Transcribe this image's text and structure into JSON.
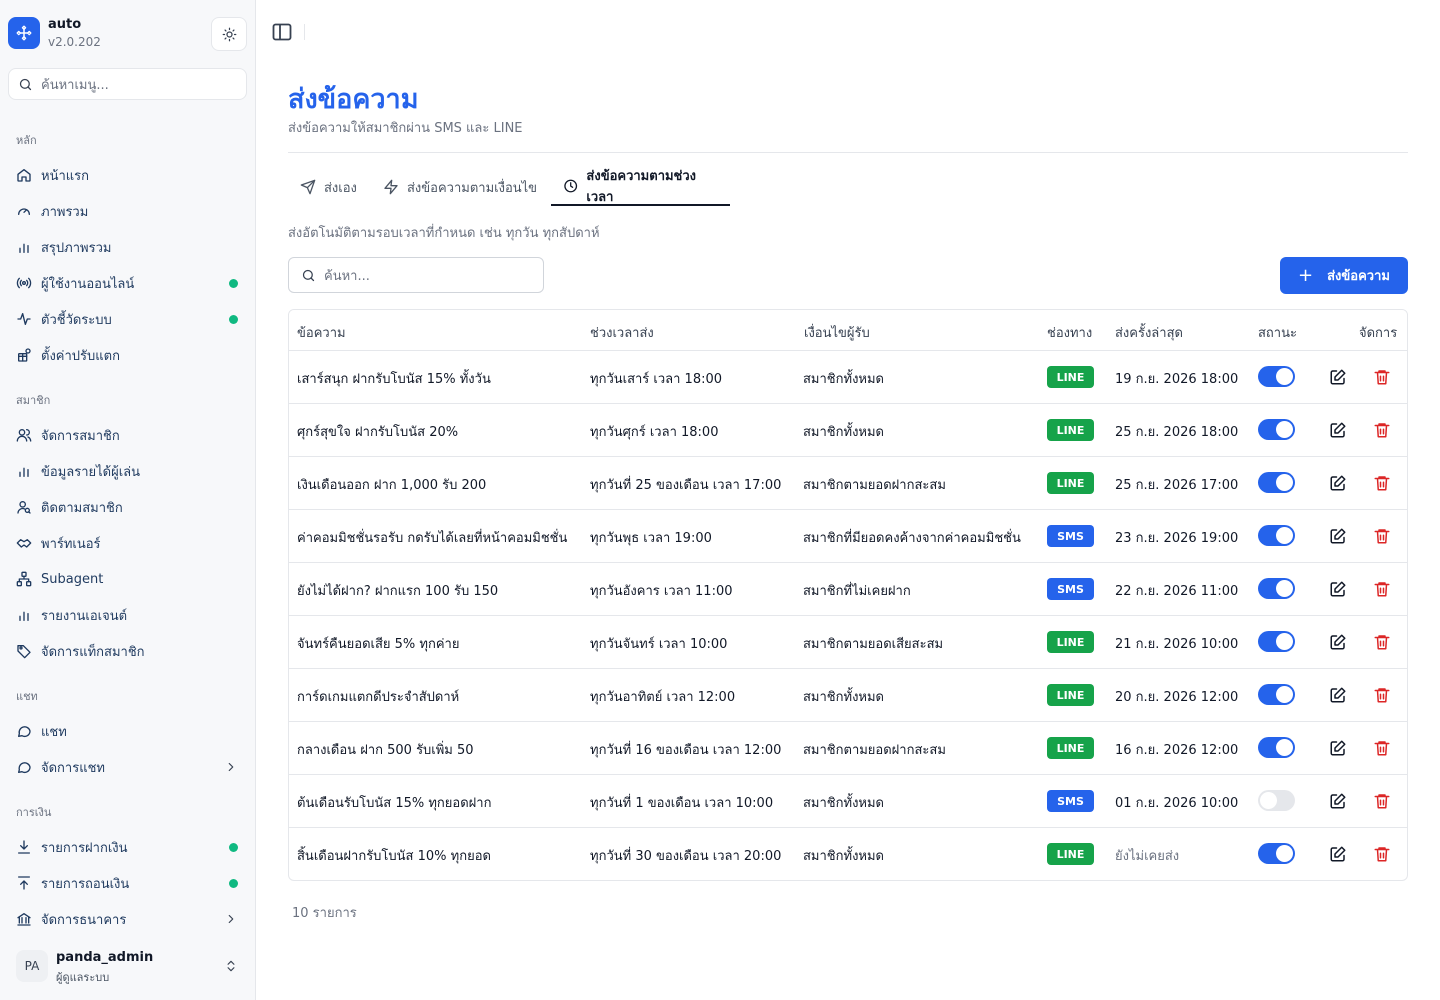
{
  "app": {
    "name": "auto",
    "version": "v2.0.202"
  },
  "menu_search": {
    "placeholder": "ค้นหาเมนู..."
  },
  "sidebar": {
    "sections": [
      {
        "label": "หลัก",
        "items": [
          {
            "label": "หน้าแรก",
            "icon": "home-icon"
          },
          {
            "label": "ภาพรวม",
            "icon": "gauge-icon"
          },
          {
            "label": "สรุปภาพรวม",
            "icon": "bar-chart-icon"
          },
          {
            "label": "ผู้ใช้งานออนไลน์",
            "icon": "broadcast-icon",
            "status_dot": true
          },
          {
            "label": "ตัวชี้วัดระบบ",
            "icon": "activity-icon",
            "status_dot": true
          },
          {
            "label": "ตั้งค่าปรับแตก",
            "icon": "gift-settings-icon"
          }
        ]
      },
      {
        "label": "สมาชิก",
        "items": [
          {
            "label": "จัดการสมาชิก",
            "icon": "users-icon"
          },
          {
            "label": "ข้อมูลรายได้ผู้เล่น",
            "icon": "bar-chart-icon"
          },
          {
            "label": "ติดตามสมาชิก",
            "icon": "user-search-icon"
          },
          {
            "label": "พาร์ทเนอร์",
            "icon": "handshake-icon"
          },
          {
            "label": "Subagent",
            "icon": "network-icon"
          },
          {
            "label": "รายงานเอเจนต์",
            "icon": "bar-chart-icon"
          },
          {
            "label": "จัดการแท็กสมาชิก",
            "icon": "tag-icon"
          }
        ]
      },
      {
        "label": "แชท",
        "items": [
          {
            "label": "แชท",
            "icon": "chat-icon"
          },
          {
            "label": "จัดการแชท",
            "icon": "chat-icon",
            "expandable": true
          }
        ]
      },
      {
        "label": "การเงิน",
        "items": [
          {
            "label": "รายการฝากเงิน",
            "icon": "download-icon",
            "status_dot": true
          },
          {
            "label": "รายการถอนเงิน",
            "icon": "upload-icon",
            "status_dot": true
          },
          {
            "label": "จัดการธนาคาร",
            "icon": "bank-icon",
            "expandable": true
          }
        ]
      }
    ]
  },
  "user": {
    "initials": "PA",
    "name": "panda_admin",
    "role": "ผู้ดูแลระบบ"
  },
  "page": {
    "title": "ส่งข้อความ",
    "subtitle": "ส่งข้อความให้สมาชิกผ่าน SMS และ LINE"
  },
  "tabs": [
    {
      "label": "ส่งเอง",
      "icon": "send-icon",
      "active": false
    },
    {
      "label": "ส่งข้อความตามเงื่อนไข",
      "icon": "zap-icon",
      "active": false
    },
    {
      "label": "ส่งข้อความตามช่วงเวลา",
      "icon": "clock-icon",
      "active": true
    }
  ],
  "tab_description": "ส่งอัตโนมัติตามรอบเวลาที่กำหนด เช่น ทุกวัน ทุกสัปดาห์",
  "search": {
    "placeholder": "ค้นหา..."
  },
  "actions": {
    "send_message_label": "ส่งข้อความ",
    "plus": "+"
  },
  "table": {
    "columns": [
      "ข้อความ",
      "ช่วงเวลาส่ง",
      "เงื่อนไขผู้รับ",
      "ช่องทาง",
      "ส่งครั้งล่าสุด",
      "สถานะ",
      "จัดการ"
    ],
    "rows": [
      {
        "message": "เสาร์สนุก ฝากรับโบนัส 15% ทั้งวัน",
        "schedule": "ทุกวันเสาร์ เวลา 18:00",
        "recipients": "สมาชิกทั้งหมด",
        "channel": "LINE",
        "last_sent": "19 ก.ย. 2026 18:00",
        "enabled": true
      },
      {
        "message": "ศุกร์สุขใจ ฝากรับโบนัส 20%",
        "schedule": "ทุกวันศุกร์ เวลา 18:00",
        "recipients": "สมาชิกทั้งหมด",
        "channel": "LINE",
        "last_sent": "25 ก.ย. 2026 18:00",
        "enabled": true
      },
      {
        "message": "เงินเดือนออก ฝาก 1,000 รับ 200",
        "schedule": "ทุกวันที่ 25 ของเดือน เวลา 17:00",
        "recipients": "สมาชิกตามยอดฝากสะสม",
        "channel": "LINE",
        "last_sent": "25 ก.ย. 2026 17:00",
        "enabled": true
      },
      {
        "message": "ค่าคอมมิชชั่นรอรับ กดรับได้เลยที่หน้าคอมมิชชั่น",
        "schedule": "ทุกวันพุธ เวลา 19:00",
        "recipients": "สมาชิกที่มียอดคงค้างจากค่าคอมมิชชั่น",
        "channel": "SMS",
        "last_sent": "23 ก.ย. 2026 19:00",
        "enabled": true
      },
      {
        "message": "ยังไม่ได้ฝาก? ฝากแรก 100 รับ 150",
        "schedule": "ทุกวันอังคาร เวลา 11:00",
        "recipients": "สมาชิกที่ไม่เคยฝาก",
        "channel": "SMS",
        "last_sent": "22 ก.ย. 2026 11:00",
        "enabled": true
      },
      {
        "message": "จันทร์คืนยอดเสีย 5% ทุกค่าย",
        "schedule": "ทุกวันจันทร์ เวลา 10:00",
        "recipients": "สมาชิกตามยอดเสียสะสม",
        "channel": "LINE",
        "last_sent": "21 ก.ย. 2026 10:00",
        "enabled": true
      },
      {
        "message": "การ์ดเกมแตกดีประจำสัปดาห์",
        "schedule": "ทุกวันอาทิตย์ เวลา 12:00",
        "recipients": "สมาชิกทั้งหมด",
        "channel": "LINE",
        "last_sent": "20 ก.ย. 2026 12:00",
        "enabled": true
      },
      {
        "message": "กลางเดือน ฝาก 500 รับเพิ่ม 50",
        "schedule": "ทุกวันที่ 16 ของเดือน เวลา 12:00",
        "recipients": "สมาชิกตามยอดฝากสะสม",
        "channel": "LINE",
        "last_sent": "16 ก.ย. 2026 12:00",
        "enabled": true
      },
      {
        "message": "ต้นเดือนรับโบนัส 15% ทุกยอดฝาก",
        "schedule": "ทุกวันที่ 1 ของเดือน เวลา 10:00",
        "recipients": "สมาชิกทั้งหมด",
        "channel": "SMS",
        "last_sent": "01 ก.ย. 2026 10:00",
        "enabled": false
      },
      {
        "message": "สิ้นเดือนฝากรับโบนัส 10% ทุกยอด",
        "schedule": "ทุกวันที่ 30 ของเดือน เวลา 20:00",
        "recipients": "สมาชิกทั้งหมด",
        "channel": "LINE",
        "last_sent": "ยังไม่เคยส่ง",
        "last_sent_muted": true,
        "enabled": true
      }
    ]
  },
  "footer": {
    "count_label": "10 รายการ"
  },
  "colors": {
    "primary": "#2563eb",
    "line": "#16a34a",
    "sms": "#2563eb",
    "danger": "#dc2626",
    "online": "#10b981"
  }
}
